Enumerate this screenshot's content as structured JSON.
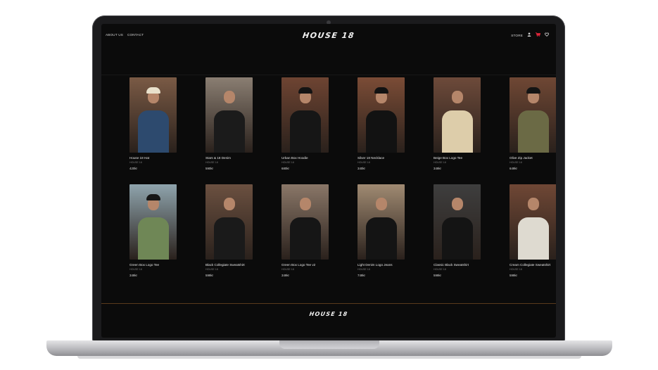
{
  "header": {
    "nav_left": [
      "ABOUT US",
      "CONTACT"
    ],
    "brand": "HOUSE 18",
    "store_label": "STORE",
    "icons": [
      "user-icon",
      "cart-icon",
      "heart-icon"
    ],
    "cart_color": "#e0263a"
  },
  "products": [
    {
      "name": "House 18 Hat",
      "brand": "HOUSE 18",
      "price": "420kr",
      "bg": "#7a5a45",
      "top": "#2d4a6e",
      "cap": "#e9e1cc"
    },
    {
      "name": "Stars & 18 Denim",
      "brand": "HOUSE 18",
      "price": "590kr",
      "bg": "#8a7e72",
      "top": "#1b1b1b",
      "cap": ""
    },
    {
      "name": "Urban Box Hoodie",
      "brand": "HOUSE 18",
      "price": "680kr",
      "bg": "#6e4432",
      "top": "#161616",
      "cap": "#141414"
    },
    {
      "name": "Silver 18 Necklace",
      "brand": "HOUSE 18",
      "price": "340kr",
      "bg": "#7b4c36",
      "top": "#121212",
      "cap": "#121212"
    },
    {
      "name": "Beige Box Logo Tee",
      "brand": "HOUSE 18",
      "price": "349kr",
      "bg": "#6d4a3a",
      "top": "#ddcdaa",
      "cap": ""
    },
    {
      "name": "Olive Zip Jacket",
      "brand": "HOUSE 18",
      "price": "649kr",
      "bg": "#6f4734",
      "top": "#6b6a45",
      "cap": "#141414"
    },
    {
      "name": "Green Box Logo Tee",
      "brand": "HOUSE 18",
      "price": "349kr",
      "bg": "#8fa4ad",
      "top": "#6f8756",
      "cap": "#161616"
    },
    {
      "name": "Black Collegiate Sweatshirt",
      "brand": "HOUSE 18",
      "price": "599kr",
      "bg": "#6b5040",
      "top": "#1a1a1a",
      "cap": ""
    },
    {
      "name": "Green Box Logo Tee v2",
      "brand": "HOUSE 18",
      "price": "349kr",
      "bg": "#8a7768",
      "top": "#161616",
      "cap": ""
    },
    {
      "name": "Light Denim Logo Jeans",
      "brand": "HOUSE 18",
      "price": "749kr",
      "bg": "#a08a72",
      "top": "#141414",
      "cap": ""
    },
    {
      "name": "Classic Black Sweatshirt",
      "brand": "HOUSE 18",
      "price": "599kr",
      "bg": "#3e3e3e",
      "top": "#141414",
      "cap": ""
    },
    {
      "name": "Cream Collegiate Sweatshirt",
      "brand": "HOUSE 18",
      "price": "599kr",
      "bg": "#6f4735",
      "top": "#dedad0",
      "cap": ""
    }
  ],
  "footer": {
    "brand": "HOUSE 18"
  }
}
